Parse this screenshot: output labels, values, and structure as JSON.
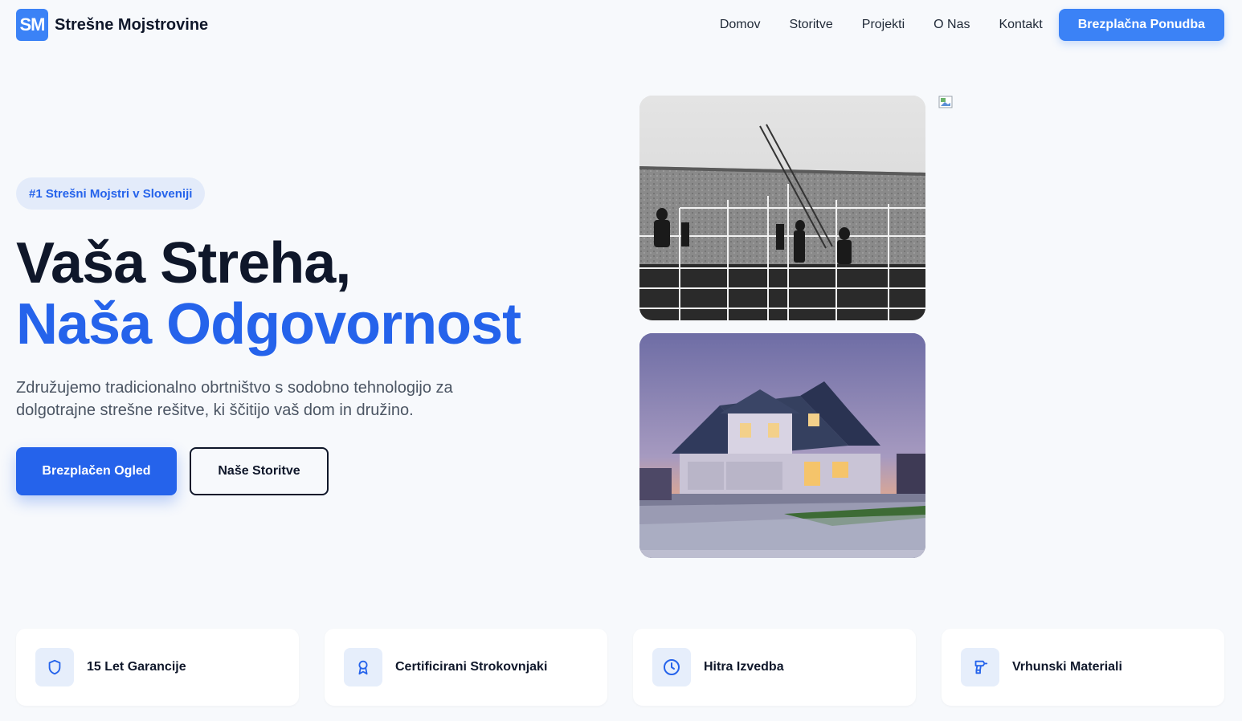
{
  "nav": {
    "logo_text": "SM",
    "brand_name": "Strešne Mojstrovine",
    "links": [
      "Domov",
      "Storitve",
      "Projekti",
      "O Nas",
      "Kontakt"
    ],
    "cta": "Brezplačna Ponudba"
  },
  "hero": {
    "badge": "#1 Strešni Mojstri v Sloveniji",
    "title_line1": "Vaša Streha,",
    "title_line2": "Naša Odgovornost",
    "lead": "Združujemo tradicionalno obrtništvo s sodobno tehnologijo za dolgotrajne strešne rešitve, ki ščitijo vaš dom in družino.",
    "primary_button": "Brezplačen Ogled",
    "secondary_button": "Naše Storitve"
  },
  "features": [
    {
      "label": "15 Let Garancije",
      "icon": "shield-icon"
    },
    {
      "label": "Certificirani Strokovnjaki",
      "icon": "award-icon"
    },
    {
      "label": "Hitra Izvedba",
      "icon": "clock-icon"
    },
    {
      "label": "Vrhunski Materiali",
      "icon": "drill-icon"
    }
  ],
  "colors": {
    "accent": "#2563eb",
    "accent_light": "#3b82f6",
    "background": "#f7f9fc",
    "text_dark": "#0f172a"
  }
}
